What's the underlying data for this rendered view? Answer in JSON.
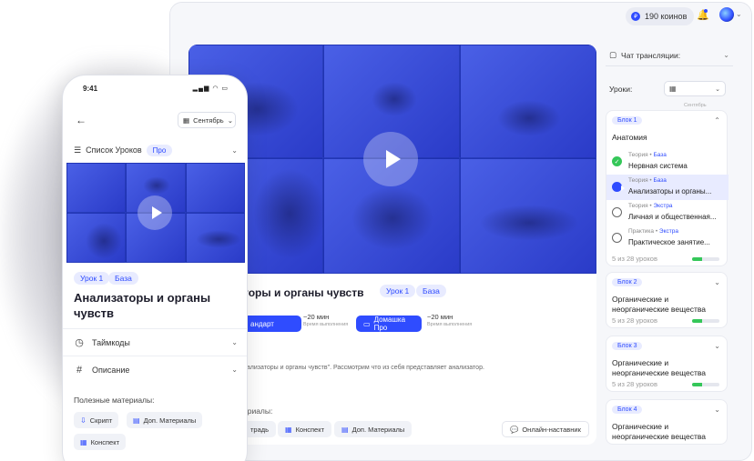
{
  "desktop": {
    "coins": "190 коинов",
    "video_title_partial": "торы и органы чувств",
    "tags": [
      "Урок 1",
      "База"
    ],
    "btn_standard": "андарт",
    "btn_homework": "Домашка Про",
    "time1": "~20 мин",
    "time1_sub": "Время выполнения",
    "time2": "~20 мин",
    "time2_sub": "Время выполнения",
    "description": "нализаторы и органы чувств\". Рассмотрим что из себя представляет анализатор.",
    "materials_label": "ериалы:",
    "chips": [
      "традь",
      "Конспект",
      "Доп. Материалы"
    ],
    "mentor": "Онлайн-наставник"
  },
  "sidebar": {
    "chat": "Чат трансляции:",
    "lessons_label": "Уроки:",
    "month_small": "Сентябрь",
    "blocks": [
      {
        "tag": "Блок 1",
        "name": "Анатомия",
        "lessons": [
          {
            "type": "Теория",
            "level": "База",
            "name": "Нервная система",
            "state": "done"
          },
          {
            "type": "Теория",
            "level": "База",
            "name": "Анализаторы и органы...",
            "state": "active"
          },
          {
            "type": "Теория",
            "level": "Экстра",
            "name": "Личная и общественная...",
            "state": "todo"
          },
          {
            "type": "Практика",
            "level": "Экстра",
            "name": "Практическое занятие...",
            "state": "todo"
          }
        ],
        "progress": "5 из 28 уроков",
        "progress_value": 0.35
      },
      {
        "tag": "Блок 2",
        "name": "Органические и неорганические вещества",
        "progress": "5 из 28 уроков",
        "progress_value": 0.35
      },
      {
        "tag": "Блок 3",
        "name": "Органические и неорганические вещества",
        "progress": "5 из 28 уроков",
        "progress_value": 0.35
      },
      {
        "tag": "Блок 4",
        "name": "Органические и неорганические вещества"
      }
    ]
  },
  "phone": {
    "time": "9:41",
    "month": "Сентябрь",
    "list_label": "Список Уроков",
    "list_tag": "Про",
    "tags": [
      "Урок 1",
      "База"
    ],
    "title": "Анализаторы и органы чувств",
    "timecodes": "Таймкоды",
    "description": "Описание",
    "materials_label": "Полезные материалы:",
    "chips": [
      "Скрипт",
      "Доп. Материалы",
      "Конспект"
    ]
  }
}
